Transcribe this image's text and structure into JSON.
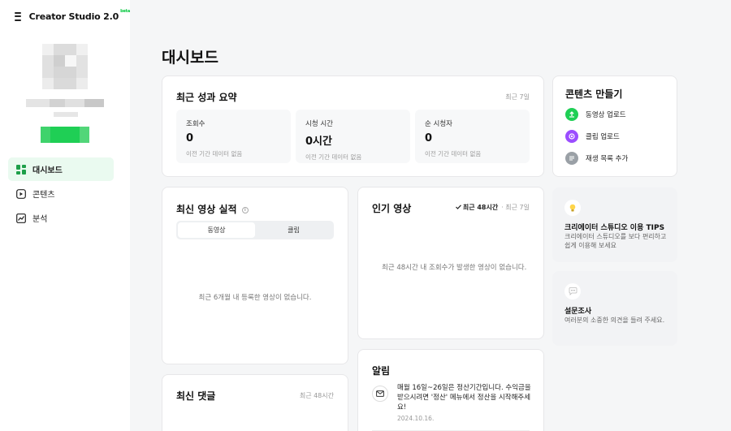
{
  "app": {
    "brand": "Creator Studio 2.0",
    "brand_tag": "beta"
  },
  "sidebar": {
    "items": [
      {
        "label": "대시보드",
        "icon": "dashboard-icon",
        "active": true
      },
      {
        "label": "콘텐츠",
        "icon": "content-icon",
        "active": false
      },
      {
        "label": "분석",
        "icon": "analytics-icon",
        "active": false
      }
    ]
  },
  "page": {
    "title": "대시보드"
  },
  "summary": {
    "title": "최근 성과 요약",
    "period": "최근 7일",
    "stats": [
      {
        "label": "조회수",
        "value": "0",
        "note": "이전 기간 데이터 없음"
      },
      {
        "label": "시청 시간",
        "value": "0시간",
        "note": "이전 기간 데이터 없음"
      },
      {
        "label": "순 시청자",
        "value": "0",
        "note": "이전 기간 데이터 없음"
      }
    ]
  },
  "create": {
    "title": "콘텐츠 만들기",
    "items": [
      {
        "label": "동영상 업로드",
        "icon": "upload-icon",
        "color": "#1fcf55"
      },
      {
        "label": "클립 업로드",
        "icon": "clip-icon",
        "color": "#9b4dff"
      },
      {
        "label": "재생 목록 추가",
        "icon": "playlist-icon",
        "color": "#9aa0a6"
      }
    ]
  },
  "recent_video": {
    "title": "최신 영상 실적",
    "tabs": [
      "동영상",
      "클립"
    ],
    "empty": "최근 6개월 내 등록한 영상이 없습니다."
  },
  "popular": {
    "title": "인기 영상",
    "filter_selected": "최근 48시간",
    "filter_other": "최근 7일",
    "empty": "최근 48시간 내 조회수가 발생한 영상이 없습니다."
  },
  "tips": {
    "title": "크리에이터 스튜디오 이용 TIPS",
    "desc": "크리에이터 스튜디오를 보다 편리하고 쉽게 이용해 보세요"
  },
  "survey": {
    "title": "설문조사",
    "desc": "여러분의 소중한 의견을 들려 주세요."
  },
  "comments": {
    "title": "최신 댓글",
    "period": "최근 48시간"
  },
  "alerts": {
    "title": "알림",
    "message": "매월 16일~26일은 정산기간입니다. 수익금을 받으시려면 '정산' 메뉴에서 정산을 시작해주세요!",
    "date": "2024.10.16."
  },
  "colors": {
    "accent": "#00c73c",
    "active_bg": "#eafaf0"
  }
}
